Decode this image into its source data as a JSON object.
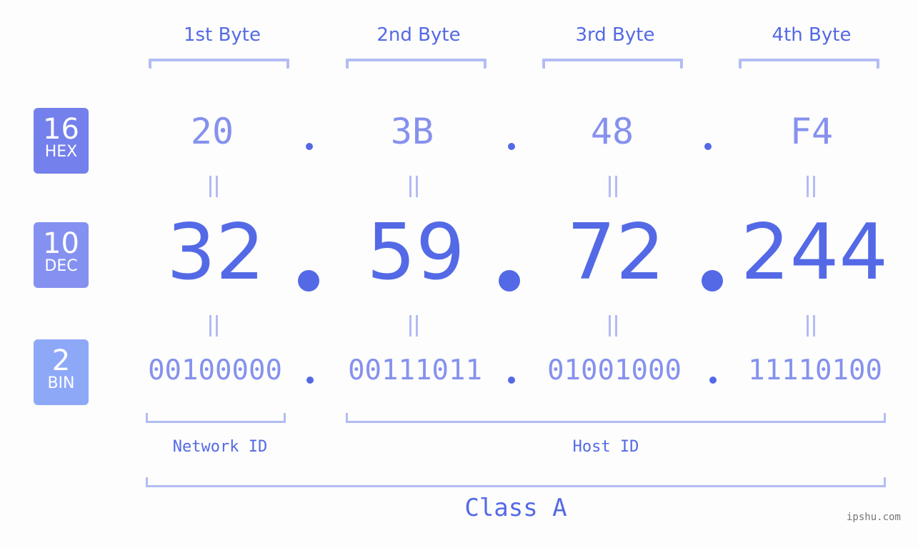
{
  "headers": [
    "1st Byte",
    "2nd Byte",
    "3rd Byte",
    "4th Byte"
  ],
  "badges": {
    "hex": {
      "number": "16",
      "label": "HEX",
      "color": "#7480eb"
    },
    "dec": {
      "number": "10",
      "label": "DEC",
      "color": "#8591f0"
    },
    "bin": {
      "number": "2",
      "label": "BIN",
      "color": "#8ea8f8"
    }
  },
  "hex_values": [
    "20",
    "3B",
    "48",
    "F4"
  ],
  "dec_values": [
    "32",
    "59",
    "72",
    "244"
  ],
  "bin_values": [
    "00100000",
    "00111011",
    "01001000",
    "11110100"
  ],
  "network_id_label": "Network ID",
  "host_id_label": "Host ID",
  "class_label": "Class A",
  "watermark": "ipshu.com",
  "colors": {
    "primary": "#5469e6",
    "secondary": "#8691ee",
    "bracket": "#b3bcf5"
  }
}
